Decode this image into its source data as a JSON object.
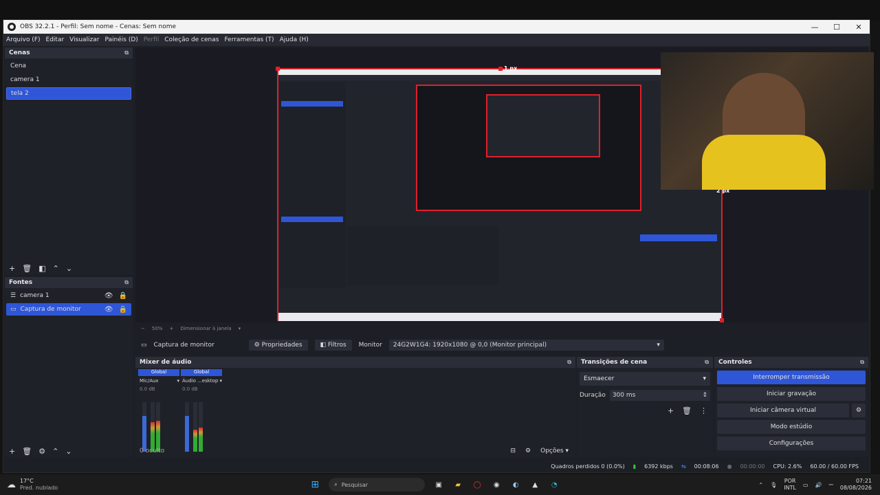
{
  "window": {
    "title": "OBS 32.2.1 - Perfil: Sem nome - Cenas: Sem nome",
    "minimize": "—",
    "maximize": "☐",
    "close": "✕"
  },
  "menu": {
    "items": [
      "Arquivo (F)",
      "Editar",
      "Visualizar",
      "Painéis (D)",
      "Perfil",
      "Coleção de cenas",
      "Ferramentas (T)",
      "Ajuda (H)"
    ]
  },
  "scenes": {
    "title": "Cenas",
    "items": [
      "Cena",
      "camera 1",
      "tela 2"
    ]
  },
  "sources": {
    "title": "Fontes",
    "items": [
      "camera 1",
      "Captura de monitor"
    ]
  },
  "preview": {
    "top_label": "1 px",
    "right_label": "2 px",
    "zoom": "50%",
    "scale_mode": "Dimensionar à janela"
  },
  "source_toolbar": {
    "source_name": "Captura de monitor",
    "properties": "Propriedades",
    "filters": "Filtros",
    "monitor_label": "Monitor",
    "monitor_value": "24G2W1G4: 1920x1080 @ 0,0 (Monitor principal)"
  },
  "mixer": {
    "title": "Mixer de áudio",
    "channels": [
      {
        "tag": "Global",
        "name": "Mic/Aux",
        "db": "0.0 dB"
      },
      {
        "tag": "Global",
        "name": "Áudio ...esktop",
        "db": "0.0 dB"
      }
    ],
    "scale": [
      "0",
      "-6",
      "-12",
      "-18",
      "-24",
      "-30",
      "-36",
      "-42",
      "-48",
      "-54",
      "-60"
    ],
    "hidden": "0 oculto",
    "options": "Opções"
  },
  "transitions": {
    "title": "Transições de cena",
    "selected": "Esmaecer",
    "duration_label": "Duração",
    "duration_value": "300 ms"
  },
  "controls": {
    "title": "Controles",
    "stop_stream": "Interromper transmissão",
    "start_recording": "Iniciar gravação",
    "start_virtual_cam": "Iniciar câmera virtual",
    "studio_mode": "Modo estúdio",
    "settings": "Configurações"
  },
  "status": {
    "dropped_frames": "Quadros perdidos 0 (0.0%)",
    "bitrate": "6392 kbps",
    "stream_time": "00:08:06",
    "rec_time": "00:00:00",
    "cpu": "CPU: 2.6%",
    "fps": "60.00 / 60.00 FPS"
  },
  "taskbar": {
    "weather_temp": "17°C",
    "weather_desc": "Pred. nublado",
    "search_placeholder": "Pesquisar",
    "lang": "POR",
    "layout": "INTL",
    "time": "07:21",
    "date": "08/08/2026"
  }
}
